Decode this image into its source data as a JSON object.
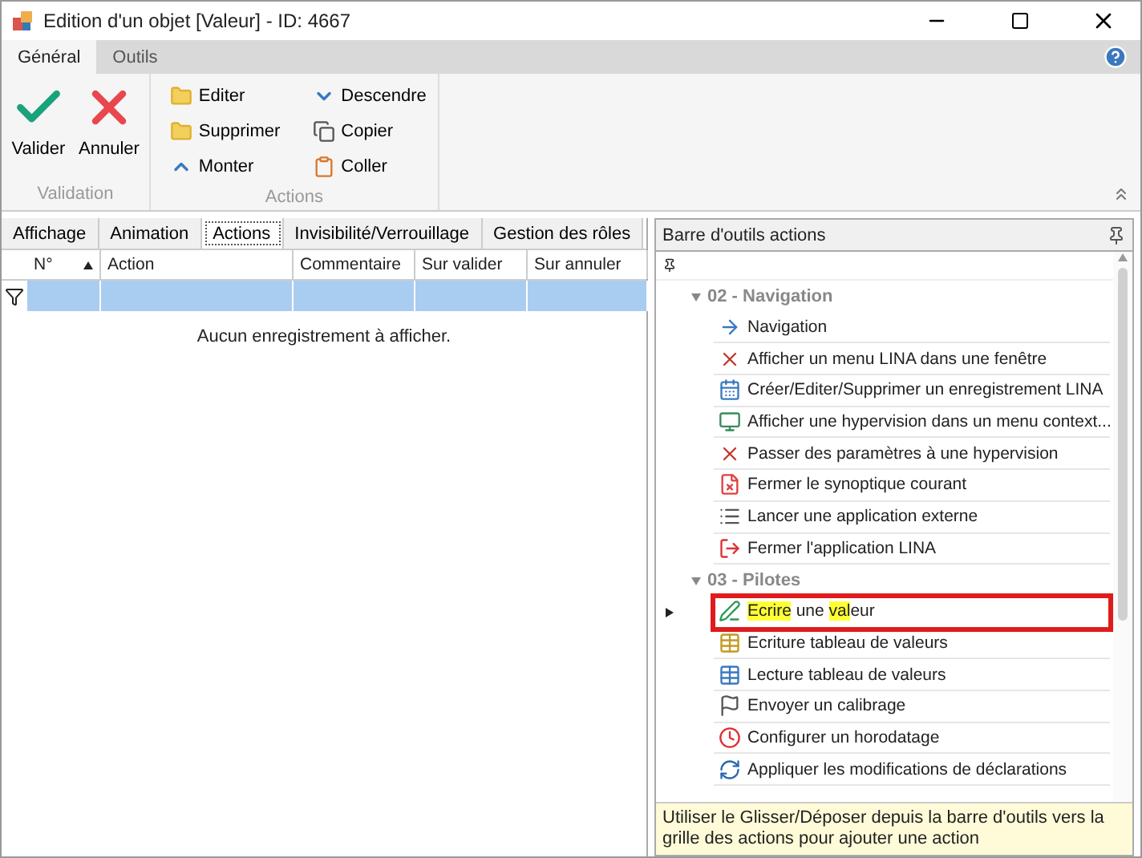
{
  "window": {
    "title": "Edition d'un objet [Valeur] - ID: 4667"
  },
  "ribbon_tabs": [
    {
      "label": "Général",
      "selected": true
    },
    {
      "label": "Outils",
      "selected": false
    }
  ],
  "ribbon_groups": [
    {
      "label": "Validation",
      "buttons": [
        "Valider",
        "Annuler"
      ]
    },
    {
      "label": "Actions",
      "buttons": [
        "Editer",
        "Supprimer",
        "Monter",
        "Descendre",
        "Copier",
        "Coller"
      ]
    }
  ],
  "editor_tabs": [
    {
      "label": "Affichage",
      "selected": false
    },
    {
      "label": "Animation",
      "selected": false
    },
    {
      "label": "Actions",
      "selected": true
    },
    {
      "label": "Invisibilité/Verrouillage",
      "selected": false
    },
    {
      "label": "Gestion des rôles",
      "selected": false
    }
  ],
  "grid": {
    "columns": [
      {
        "label": "N°",
        "sorted": true
      },
      {
        "label": "Action",
        "sorted": false
      },
      {
        "label": "Commentaire",
        "sorted": false
      },
      {
        "label": "Sur valider",
        "sorted": false
      },
      {
        "label": "Sur annuler",
        "sorted": false
      }
    ],
    "empty_message": "Aucun enregistrement à afficher."
  },
  "toolbox": {
    "title": "Barre d'outils actions",
    "groups": [
      {
        "label": "02 - Navigation",
        "expanded": true,
        "items": [
          {
            "label": "Navigation",
            "selected": false
          },
          {
            "label": "Afficher un menu LINA dans une fenêtre",
            "selected": false
          },
          {
            "label": "Créer/Editer/Supprimer un enregistrement LINA",
            "selected": false
          },
          {
            "label": "Afficher une hypervision dans un menu context...",
            "selected": false
          },
          {
            "label": "Passer des paramètres à une hypervision",
            "selected": false
          },
          {
            "label": "Fermer le synoptique courant",
            "selected": false
          },
          {
            "label": "Lancer une application externe",
            "selected": false
          },
          {
            "label": "Fermer l'application LINA",
            "selected": false
          }
        ]
      },
      {
        "label": "03 - Pilotes",
        "expanded": true,
        "items": [
          {
            "parts": [
              {
                "text": "Ecrire",
                "match": true
              },
              {
                "text": " une ",
                "match": false
              },
              {
                "text": "val",
                "match": true
              },
              {
                "text": "eur",
                "match": false
              }
            ],
            "selected": true
          },
          {
            "label": "Ecriture tableau de valeurs",
            "selected": false
          },
          {
            "label": "Lecture tableau de valeurs",
            "selected": false
          },
          {
            "label": "Envoyer un calibrage",
            "selected": false
          },
          {
            "label": "Configurer un horodatage",
            "selected": false
          },
          {
            "label": "Appliquer les modifications de déclarations",
            "selected": false
          }
        ]
      }
    ],
    "hint": "Utiliser le Glisser/Déposer depuis la barre d'outils vers la grille des actions pour ajouter une action"
  }
}
